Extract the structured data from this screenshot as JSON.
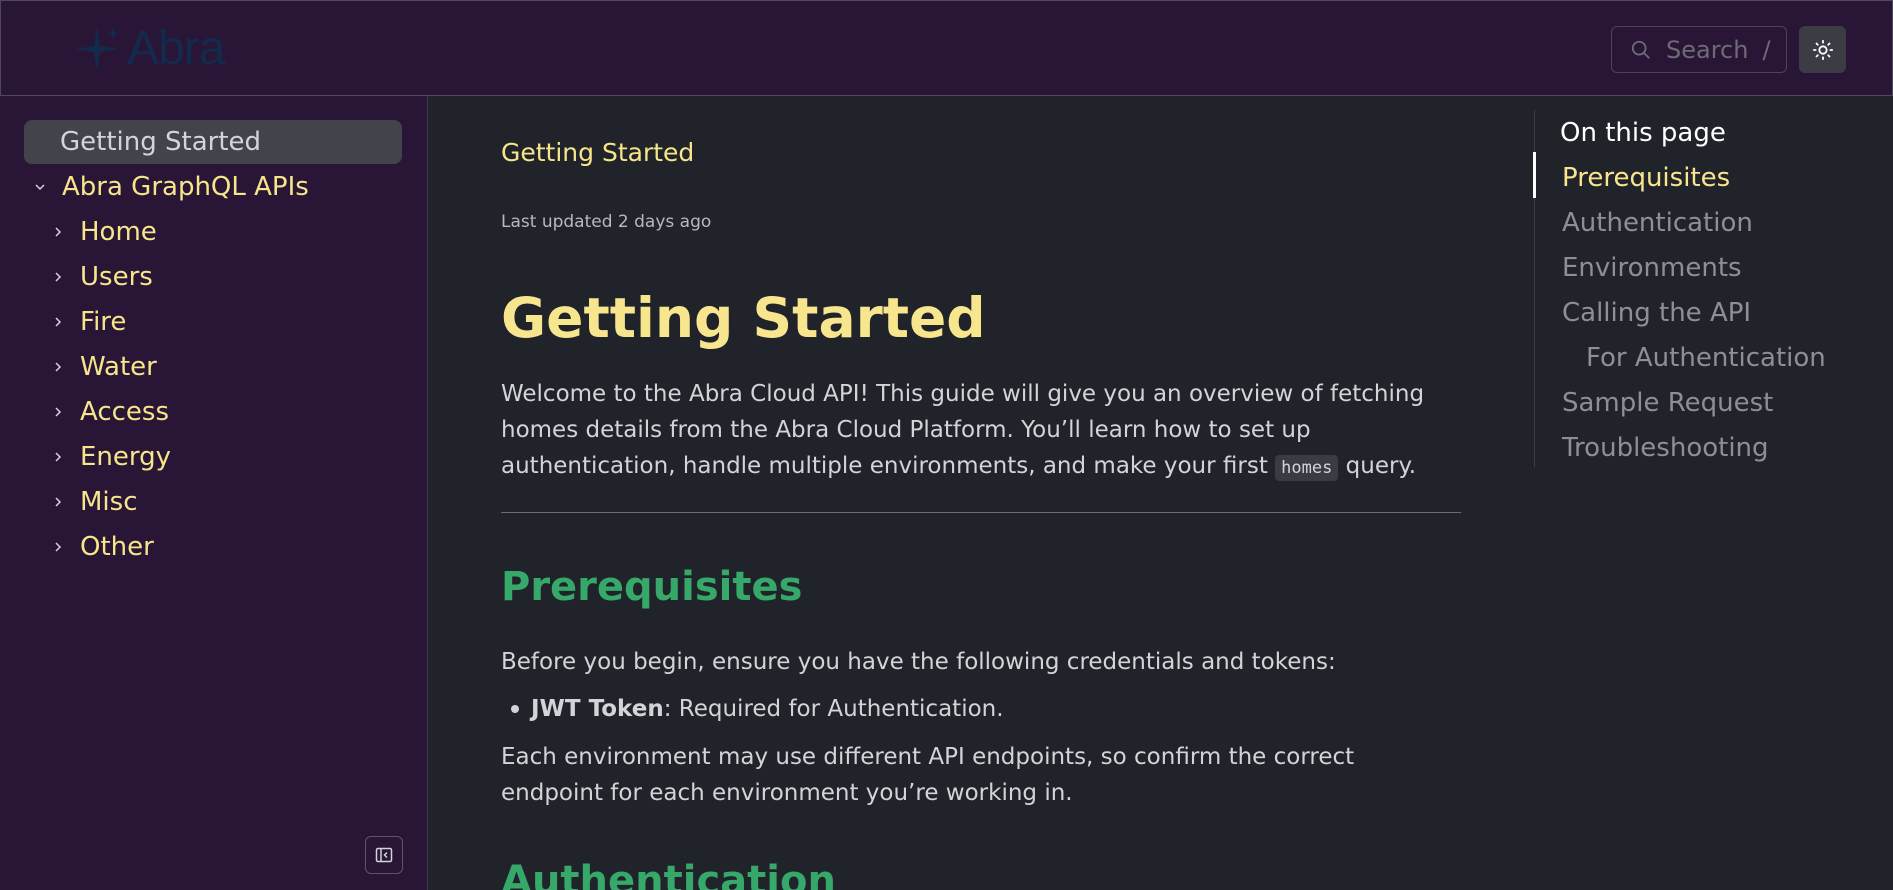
{
  "header": {
    "logo_text": "Abra",
    "search_placeholder": "Search",
    "search_shortcut": "/"
  },
  "sidebar": {
    "active_item": "Getting Started",
    "group_label": "Abra GraphQL APIs",
    "items": [
      {
        "label": "Home"
      },
      {
        "label": "Users"
      },
      {
        "label": "Fire"
      },
      {
        "label": "Water"
      },
      {
        "label": "Access"
      },
      {
        "label": "Energy"
      },
      {
        "label": "Misc"
      },
      {
        "label": "Other"
      }
    ]
  },
  "main": {
    "breadcrumb": "Getting Started",
    "last_updated": "Last updated 2 days ago",
    "title": "Getting Started",
    "intro_before_code": "Welcome to the Abra Cloud API! This guide will give you an overview of fetching homes details from the Abra Cloud Platform. You’ll learn how to set up authentication, handle multiple environments, and make your first ",
    "intro_code": "homes",
    "intro_after_code": " query.",
    "prereq_heading": "Prerequisites",
    "prereq_text": "Before you begin, ensure you have the following credentials and tokens:",
    "bullet_bold": "JWT Token",
    "bullet_rest": ": Required for Authentication.",
    "env_text": "Each environment may use different API endpoints, so confirm the correct endpoint for each environment you’re working in.",
    "auth_heading": "Authentication"
  },
  "toc": {
    "title": "On this page",
    "items": [
      {
        "label": "Prerequisites"
      },
      {
        "label": "Authentication"
      },
      {
        "label": "Environments"
      },
      {
        "label": "Calling the API"
      },
      {
        "label": "For Authentication"
      },
      {
        "label": "Sample Request"
      },
      {
        "label": "Troubleshooting"
      }
    ]
  },
  "colors": {
    "header_bg": "#291535",
    "content_bg": "#21232a",
    "accent_yellow": "#f6e58a",
    "heading_green": "#35a86a"
  },
  "icons": [
    "abra-logo-icon",
    "search-icon",
    "sun-icon",
    "chevron-down-icon",
    "chevron-right-icon",
    "collapse-sidebar-icon"
  ]
}
